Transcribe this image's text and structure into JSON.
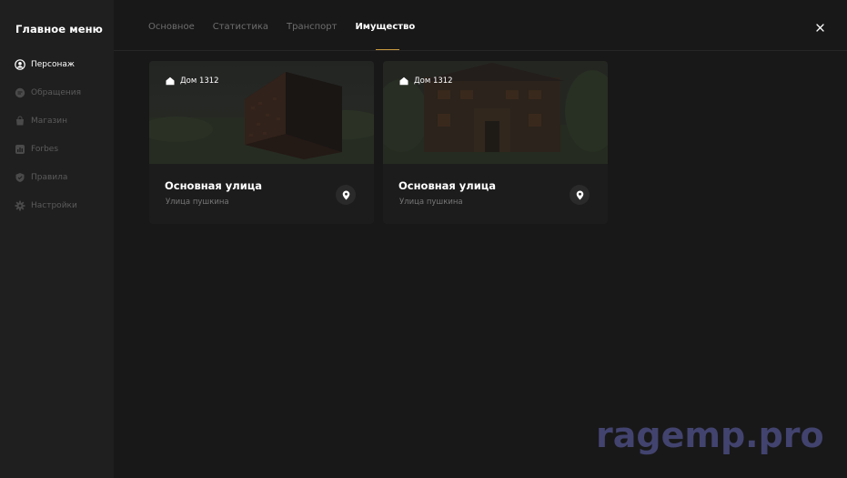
{
  "sidebar": {
    "title": "Главное меню",
    "items": [
      {
        "label": "Персонаж",
        "icon": "user-circle-icon",
        "active": true
      },
      {
        "label": "Обращения",
        "icon": "chat-icon",
        "active": false
      },
      {
        "label": "Магазин",
        "icon": "bag-icon",
        "active": false
      },
      {
        "label": "Forbes",
        "icon": "bar-chart-icon",
        "active": false
      },
      {
        "label": "Правила",
        "icon": "shield-icon",
        "active": false
      },
      {
        "label": "Настройки",
        "icon": "gear-icon",
        "active": false
      }
    ]
  },
  "tabs": [
    {
      "label": "Основное",
      "active": false
    },
    {
      "label": "Статистика",
      "active": false
    },
    {
      "label": "Транспорт",
      "active": false
    },
    {
      "label": "Имущество",
      "active": true
    }
  ],
  "accent_color": "#c79a3f",
  "properties": [
    {
      "badge": "Дом 1312",
      "street": "Основная улица",
      "address": "Улица пушкина"
    },
    {
      "badge": "Дом 1312",
      "street": "Основная улица",
      "address": "Улица пушкина"
    }
  ],
  "watermark": "ragemp.pro"
}
